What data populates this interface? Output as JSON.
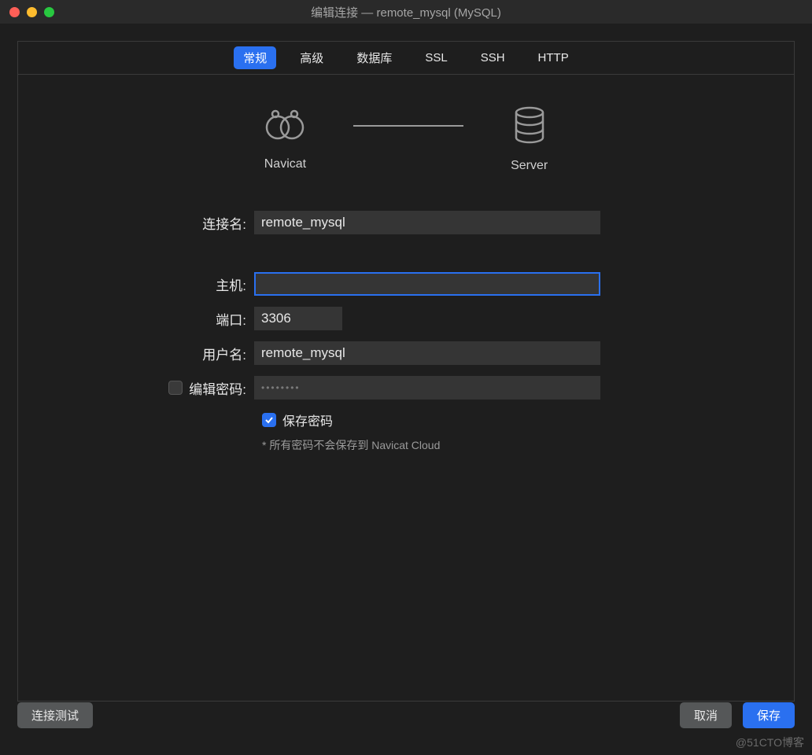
{
  "window": {
    "title": "编辑连接 — remote_mysql (MySQL)"
  },
  "tabs": {
    "general": "常规",
    "advanced": "高级",
    "database": "数据库",
    "ssl": "SSL",
    "ssh": "SSH",
    "http": "HTTP"
  },
  "diagram": {
    "left_label": "Navicat",
    "right_label": "Server"
  },
  "form": {
    "connection_name_label": "连接名:",
    "connection_name_value": "remote_mysql",
    "host_label": "主机:",
    "host_value": "",
    "port_label": "端口:",
    "port_value": "3306",
    "username_label": "用户名:",
    "username_value": "remote_mysql",
    "edit_password_label": "编辑密码:",
    "password_mask": "••••••••",
    "save_password_label": "保存密码",
    "save_password_checked": true,
    "hint": "* 所有密码不会保存到 Navicat Cloud"
  },
  "footer": {
    "test_connection": "连接测试",
    "cancel": "取消",
    "save": "保存"
  },
  "watermark": "@51CTO博客"
}
